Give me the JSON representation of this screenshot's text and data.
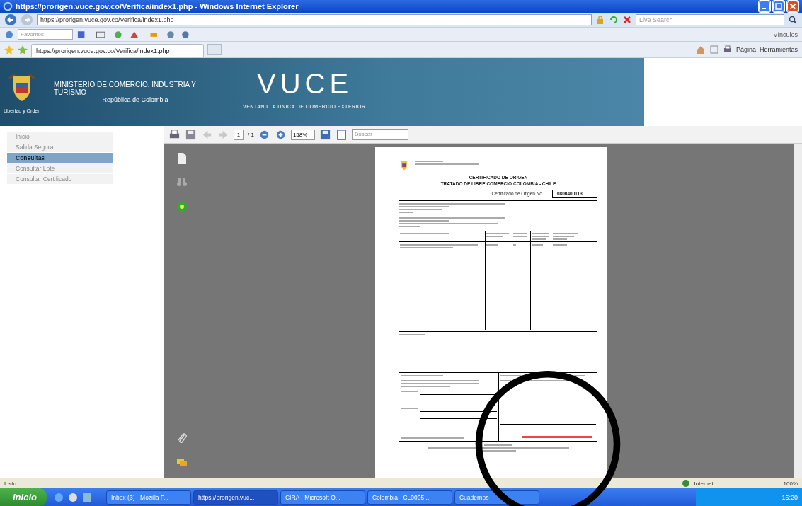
{
  "window": {
    "title": "https://prorigen.vuce.gov.co/Verifica/index1.php - Windows Internet Explorer"
  },
  "address_bar": {
    "url": "https://prorigen.vuce.gov.co/Verifica/index1.php",
    "search_placeholder": "Live Search"
  },
  "links_bar": {
    "search_placeholder": "Favoritos",
    "links_label": "Vínculos"
  },
  "tab": {
    "title": "https://prorigen.vuce.gov.co/Verifica/index1.php",
    "selected": true
  },
  "command_bar": [
    "Página",
    "Herramientas"
  ],
  "header": {
    "ministry": "MINISTERIO DE COMERCIO, INDUSTRIA Y TURISMO",
    "country": "República de Colombia",
    "motto": "Libertad y Orden",
    "logo": "VUCE",
    "tagline": "VENTANILLA UNICA DE COMERCIO EXTERIOR"
  },
  "sidebar": {
    "items": [
      {
        "label": "Inicio",
        "selected": false
      },
      {
        "label": "Salida Segura",
        "selected": false
      },
      {
        "label": "Consultas",
        "selected": true
      },
      {
        "label": "Consultar Lote",
        "selected": false
      },
      {
        "label": "Consultar Certificado",
        "selected": false
      }
    ]
  },
  "pdf_toolbar": {
    "page": "1",
    "page_count": "/ 1",
    "zoom": "158%",
    "search_placeholder": "Buscar"
  },
  "document": {
    "title": "CERTIFICADO DE ORIGEN",
    "subtitle": "TRATADO DE LIBRE COMERCIO COLOMBIA - CHILE",
    "number_label": "Certificado de Origen No",
    "number": "0800400113"
  },
  "status_bar": {
    "left": "Listo",
    "zone": "Internet",
    "zoom": "100%"
  },
  "taskbar": {
    "start": "Inicio",
    "tasks": [
      {
        "label": "Inbox (3) - Mozilla F...",
        "selected": false
      },
      {
        "label": "https://prorigen.vuc...",
        "selected": true
      },
      {
        "label": "CIRA - Microsoft O...",
        "selected": false
      },
      {
        "label": "Colombia - CL0005...",
        "selected": false
      },
      {
        "label": "Cuadernos",
        "selected": false
      }
    ],
    "clock": "15:20"
  }
}
